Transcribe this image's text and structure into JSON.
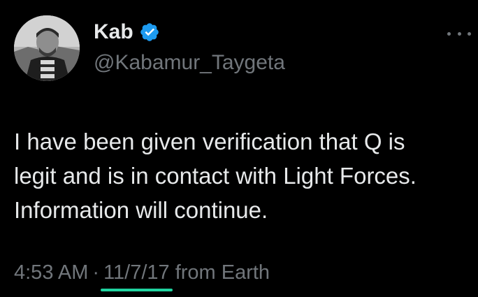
{
  "author": {
    "display_name": "Kab",
    "handle": "@Kabamur_Taygeta",
    "verified": true,
    "verified_badge_color": "#1d9bf0"
  },
  "tweet": {
    "text_lines": [
      "I have been given verification that Q is",
      "legit and is in contact with Light Forces.",
      "Information will continue."
    ],
    "time": "4:53 AM",
    "separator": "·",
    "date": "11/7/17",
    "source": "from Earth"
  },
  "colors": {
    "background": "#000000",
    "primary_text": "#e7e9ea",
    "secondary_text": "#71767b",
    "date_underline": "#1fd3a0"
  },
  "icons": {
    "more": "more-horizontal-icon",
    "verified": "verified-badge-icon"
  }
}
